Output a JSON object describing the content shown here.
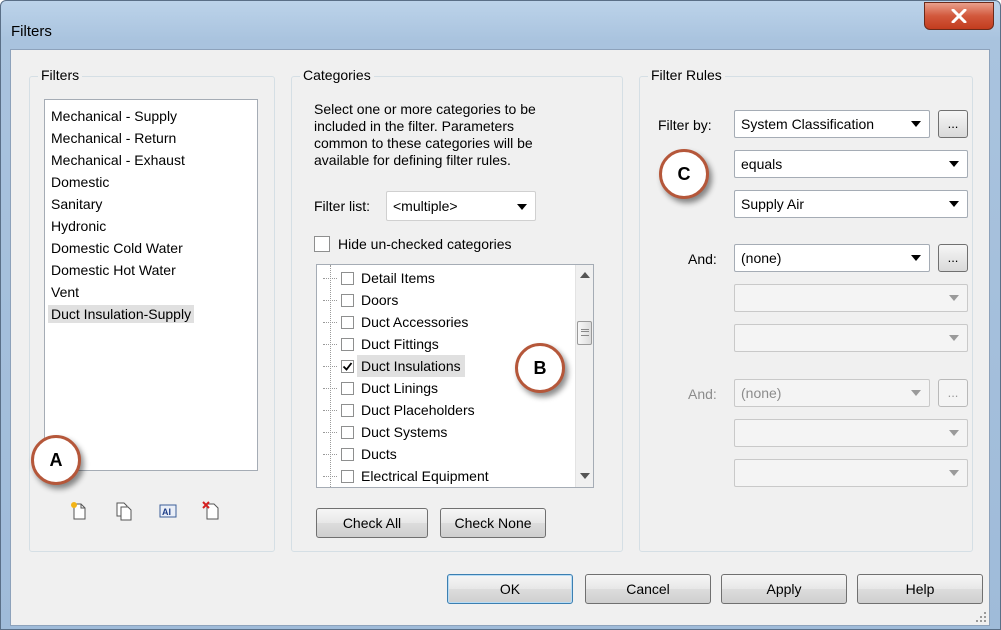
{
  "window": {
    "title": "Filters",
    "close_label": "X"
  },
  "filters_group": {
    "label": "Filters",
    "items": [
      "Mechanical - Supply",
      "Mechanical - Return",
      "Mechanical - Exhaust",
      "Domestic",
      "Sanitary",
      "Hydronic",
      "Domestic Cold Water",
      "Domestic Hot Water",
      "Vent",
      "Duct Insulation-Supply"
    ],
    "selected_index": 9,
    "toolbar": [
      "new-filter-icon",
      "duplicate-filter-icon",
      "rename-filter-icon",
      "delete-filter-icon"
    ]
  },
  "categories_group": {
    "label": "Categories",
    "instructions": [
      "Select one or more categories to be",
      "included in the filter.  Parameters",
      "common to these categories will be",
      "available for defining filter rules."
    ],
    "filter_list_label": "Filter list:",
    "filter_list_value": "<multiple>",
    "hide_unchecked_label": "Hide un-checked categories",
    "hide_unchecked": false,
    "items": [
      {
        "label": "Detail Items",
        "checked": false
      },
      {
        "label": "Doors",
        "checked": false
      },
      {
        "label": "Duct Accessories",
        "checked": false
      },
      {
        "label": "Duct Fittings",
        "checked": false
      },
      {
        "label": "Duct Insulations",
        "checked": true
      },
      {
        "label": "Duct Linings",
        "checked": false
      },
      {
        "label": "Duct Placeholders",
        "checked": false
      },
      {
        "label": "Duct Systems",
        "checked": false
      },
      {
        "label": "Ducts",
        "checked": false
      },
      {
        "label": "Electrical Equipment",
        "checked": false
      }
    ],
    "check_all_label": "Check All",
    "check_none_label": "Check None"
  },
  "filter_rules_group": {
    "label": "Filter Rules",
    "filter_by_label": "Filter by:",
    "filter_by_value": "System Classification",
    "operator_value": "equals",
    "rule_value": "Supply Air",
    "and1_label": "And:",
    "and1_value": "(none)",
    "and2_label": "And:",
    "and2_value": "(none)",
    "ellipsis": "..."
  },
  "footer": {
    "ok": "OK",
    "cancel": "Cancel",
    "apply": "Apply",
    "help": "Help"
  },
  "annotations": {
    "a": "A",
    "b": "B",
    "c": "C"
  },
  "colors": {
    "badge_border": "#b5573a",
    "titlebar": "#bcd3ea",
    "close": "#c23c1e"
  }
}
